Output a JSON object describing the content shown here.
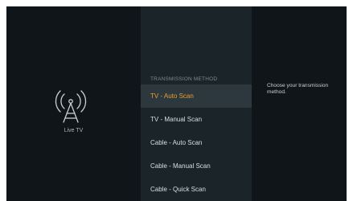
{
  "left_panel": {
    "icon": "antenna-tower-icon",
    "label": "Live TV"
  },
  "menu": {
    "heading": "TRANSMISSION METHOD",
    "items": [
      {
        "label": "TV - Auto Scan",
        "selected": true
      },
      {
        "label": "TV - Manual Scan",
        "selected": false
      },
      {
        "label": "Cable - Auto Scan",
        "selected": false
      },
      {
        "label": "Cable - Manual Scan",
        "selected": false
      },
      {
        "label": "Cable - Quick Scan",
        "selected": false
      }
    ]
  },
  "right_panel": {
    "description": "Choose your transmission method."
  },
  "colors": {
    "background": "#0f1518",
    "menu_background": "#1a2429",
    "selected_background": "#2c383e",
    "accent": "#e8a02c"
  }
}
